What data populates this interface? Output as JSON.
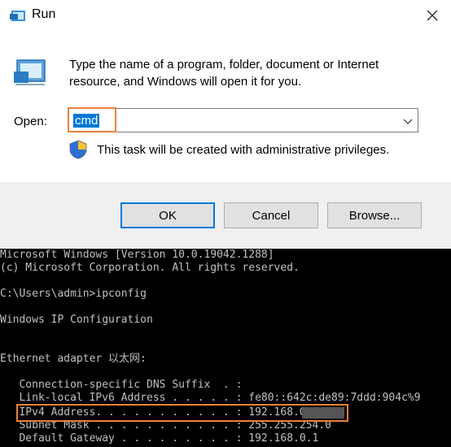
{
  "dialog": {
    "title": "Run",
    "description": "Type the name of a program, folder, document or Internet resource, and Windows will open it for you.",
    "open_label": "Open:",
    "open_value": "cmd",
    "admin_note": "This task will be created with administrative privileges.",
    "buttons": {
      "ok": "OK",
      "cancel": "Cancel",
      "browse": "Browse..."
    },
    "icons": [
      "run-app-icon",
      "close-icon",
      "chevron-down-icon",
      "uac-shield-icon"
    ]
  },
  "terminal": {
    "lines": [
      "Microsoft Windows [Version 10.0.19042.1288]",
      "(c) Microsoft Corporation. All rights reserved.",
      "",
      "C:\\Users\\admin>ipconfig",
      "",
      "Windows IP Configuration",
      "",
      "",
      "Ethernet adapter 以太网:",
      "",
      "   Connection-specific DNS Suffix  . :",
      "   Link-local IPv6 Address . . . . . : fe80::642c:de89:7ddd:904c%9",
      "   IPv4 Address. . . . . . . . . . . : 192.168.0",
      "   Subnet Mask . . . . . . . . . . . : 255.255.254.0",
      "   Default Gateway . . . . . . . . . : 192.168.0.1"
    ]
  },
  "colors": {
    "accent": "#0078d7",
    "highlight": "#e8823a",
    "terminal_text": "#c0c0c0"
  }
}
